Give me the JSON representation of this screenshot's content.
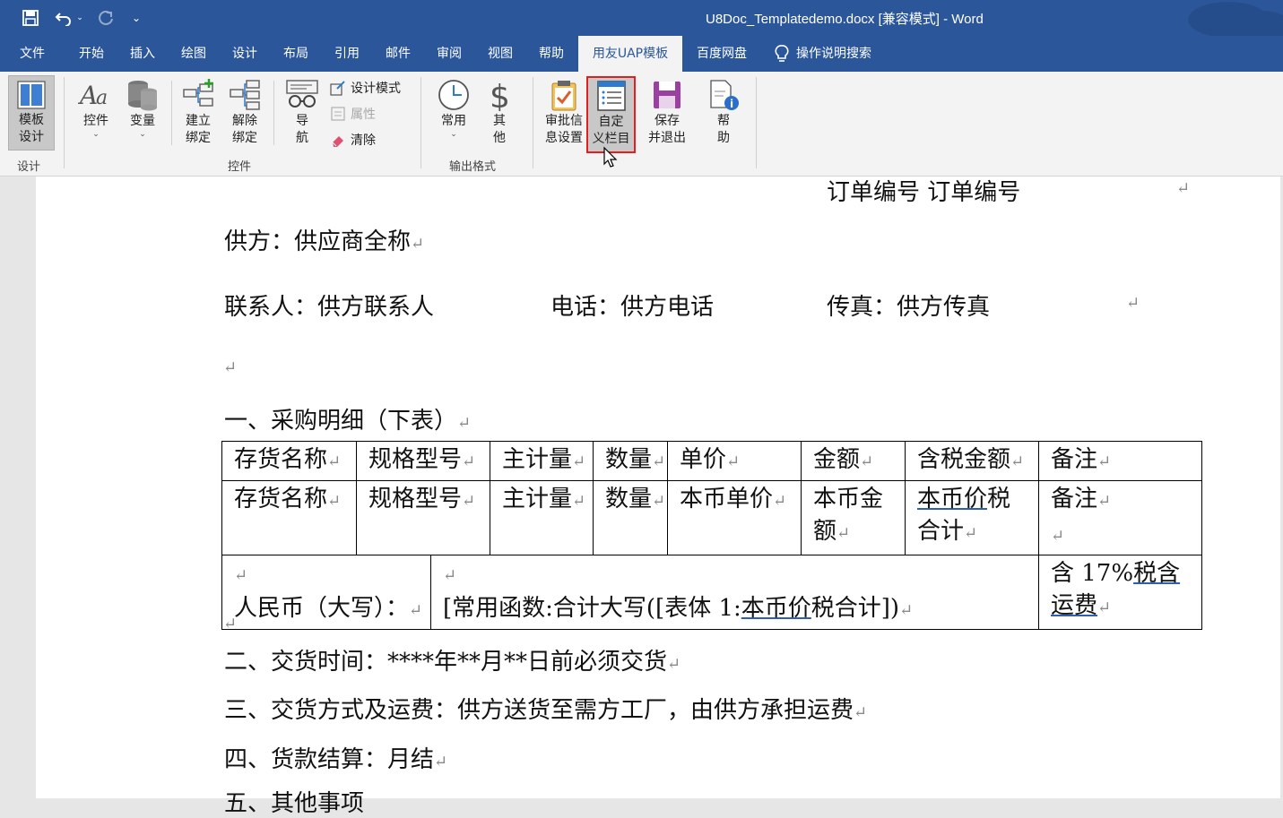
{
  "window": {
    "title": "U8Doc_Templatedemo.docx [兼容模式]  -  Word"
  },
  "qat": {
    "save_icon": "save-icon",
    "undo_icon": "undo-icon",
    "redo_icon": "redo-icon",
    "customize_icon": "customize-qat-icon"
  },
  "tabs": [
    {
      "label": "文件"
    },
    {
      "label": "开始"
    },
    {
      "label": "插入"
    },
    {
      "label": "绘图"
    },
    {
      "label": "设计"
    },
    {
      "label": "布局"
    },
    {
      "label": "引用"
    },
    {
      "label": "邮件"
    },
    {
      "label": "审阅"
    },
    {
      "label": "视图"
    },
    {
      "label": "帮助"
    },
    {
      "label": "用友UAP模板",
      "active": true
    },
    {
      "label": "百度网盘"
    },
    {
      "label": "操作说明搜索"
    }
  ],
  "ribbon": {
    "design_group": {
      "label": "设计",
      "template_design": {
        "line1": "模板",
        "line2": "设计"
      }
    },
    "controls_group": {
      "label": "控件",
      "control": {
        "label": "控件"
      },
      "variable": {
        "label": "变量"
      },
      "bind": {
        "line1": "建立",
        "line2": "绑定"
      },
      "unbind": {
        "line1": "解除",
        "line2": "绑定"
      },
      "nav": {
        "line1": "导",
        "line2": "航"
      },
      "design_mode": "设计模式",
      "properties": "属性",
      "clear": "清除"
    },
    "output_group": {
      "label": "输出格式",
      "common": {
        "label": "常用"
      },
      "other": {
        "line1": "其",
        "line2": "他"
      }
    },
    "misc": {
      "approval": {
        "line1": "审批信",
        "line2": "息设置"
      },
      "custom_cols": {
        "line1": "自定",
        "line2": "义栏目"
      },
      "save_exit": {
        "line1": "保存",
        "line2": "并退出"
      },
      "help": {
        "line1": "帮",
        "line2": "助"
      }
    },
    "colors": {
      "tab_bar": "#2b579a",
      "highlight_border": "#e02020"
    }
  },
  "document": {
    "order_no": "订单编号  订单编号",
    "supplier": "供方：供应商全称",
    "contact": "联系人：供方联系人",
    "phone": "电话：供方电话",
    "fax": "传真：供方传真",
    "section1": "一、采购明细（下表）",
    "table": {
      "header": [
        "存货名称",
        "规格型号",
        "主计量",
        "数量",
        "单价",
        "金额",
        "含税金额",
        "备注"
      ],
      "row2": [
        "存货名称",
        "规格型号",
        "主计量",
        "数量",
        "本币单价",
        "本币金额",
        "本币价税合计",
        "备注"
      ],
      "row2_amount_a": "本币金",
      "row2_amount_b": "额",
      "row2_tax_a": "本币价",
      "row2_tax_b": "税",
      "row2_tax_c": "合计",
      "total_label": "人民币（大写）：",
      "total_formula_a": "[常用函数:合计大写([表体 1:",
      "total_formula_b": "本币价",
      "total_formula_c": "税合计])",
      "tax_note_a": "含 17%",
      "tax_note_b": "税含",
      "tax_note_c": "运费"
    },
    "section2": "二、交货时间：****年**月**日前必须交货",
    "section3": "三、交货方式及运费：供方送货至需方工厂，由供方承担运费",
    "section4": "四、货款结算：月结",
    "section5": "五、其他事项",
    "para_mark": "↵"
  }
}
